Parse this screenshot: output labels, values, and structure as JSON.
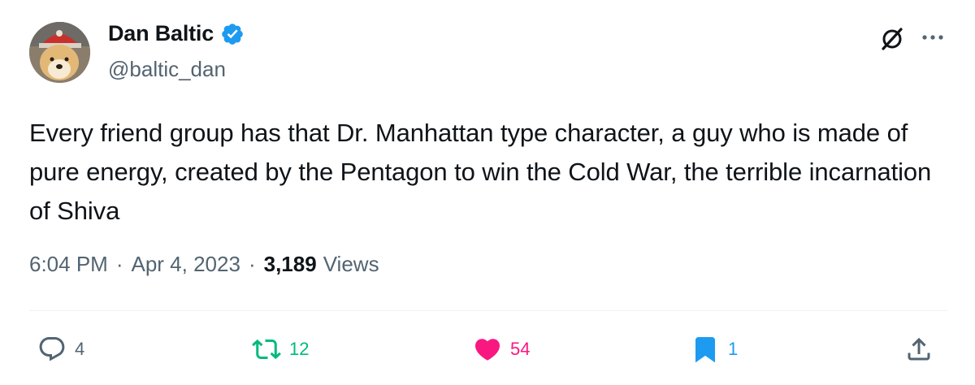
{
  "author": {
    "name": "Dan Baltic",
    "handle": "@baltic_dan",
    "verified": true,
    "verified_color": "#1d9bf0"
  },
  "header_icons": [
    "grok-icon",
    "more-options-icon"
  ],
  "tweet": {
    "text": "Every friend group has that Dr. Manhattan type character, a guy who is made of pure energy, created by the Pentagon to win the Cold War, the terrible incarnation of Shiva"
  },
  "meta": {
    "time": "6:04 PM",
    "separator": "·",
    "date": "Apr 4, 2023",
    "views_count": "3,189",
    "views_label": "Views"
  },
  "actions": {
    "reply": {
      "count": "4",
      "icon": "reply-icon",
      "color": "#536471"
    },
    "retweet": {
      "count": "12",
      "icon": "retweet-icon",
      "color": "#00ba7c"
    },
    "like": {
      "count": "54",
      "icon": "heart-icon",
      "color": "#f91880"
    },
    "bookmark": {
      "count": "1",
      "icon": "bookmark-icon",
      "color": "#1d9bf0"
    },
    "share": {
      "icon": "share-icon",
      "color": "#536471"
    }
  }
}
